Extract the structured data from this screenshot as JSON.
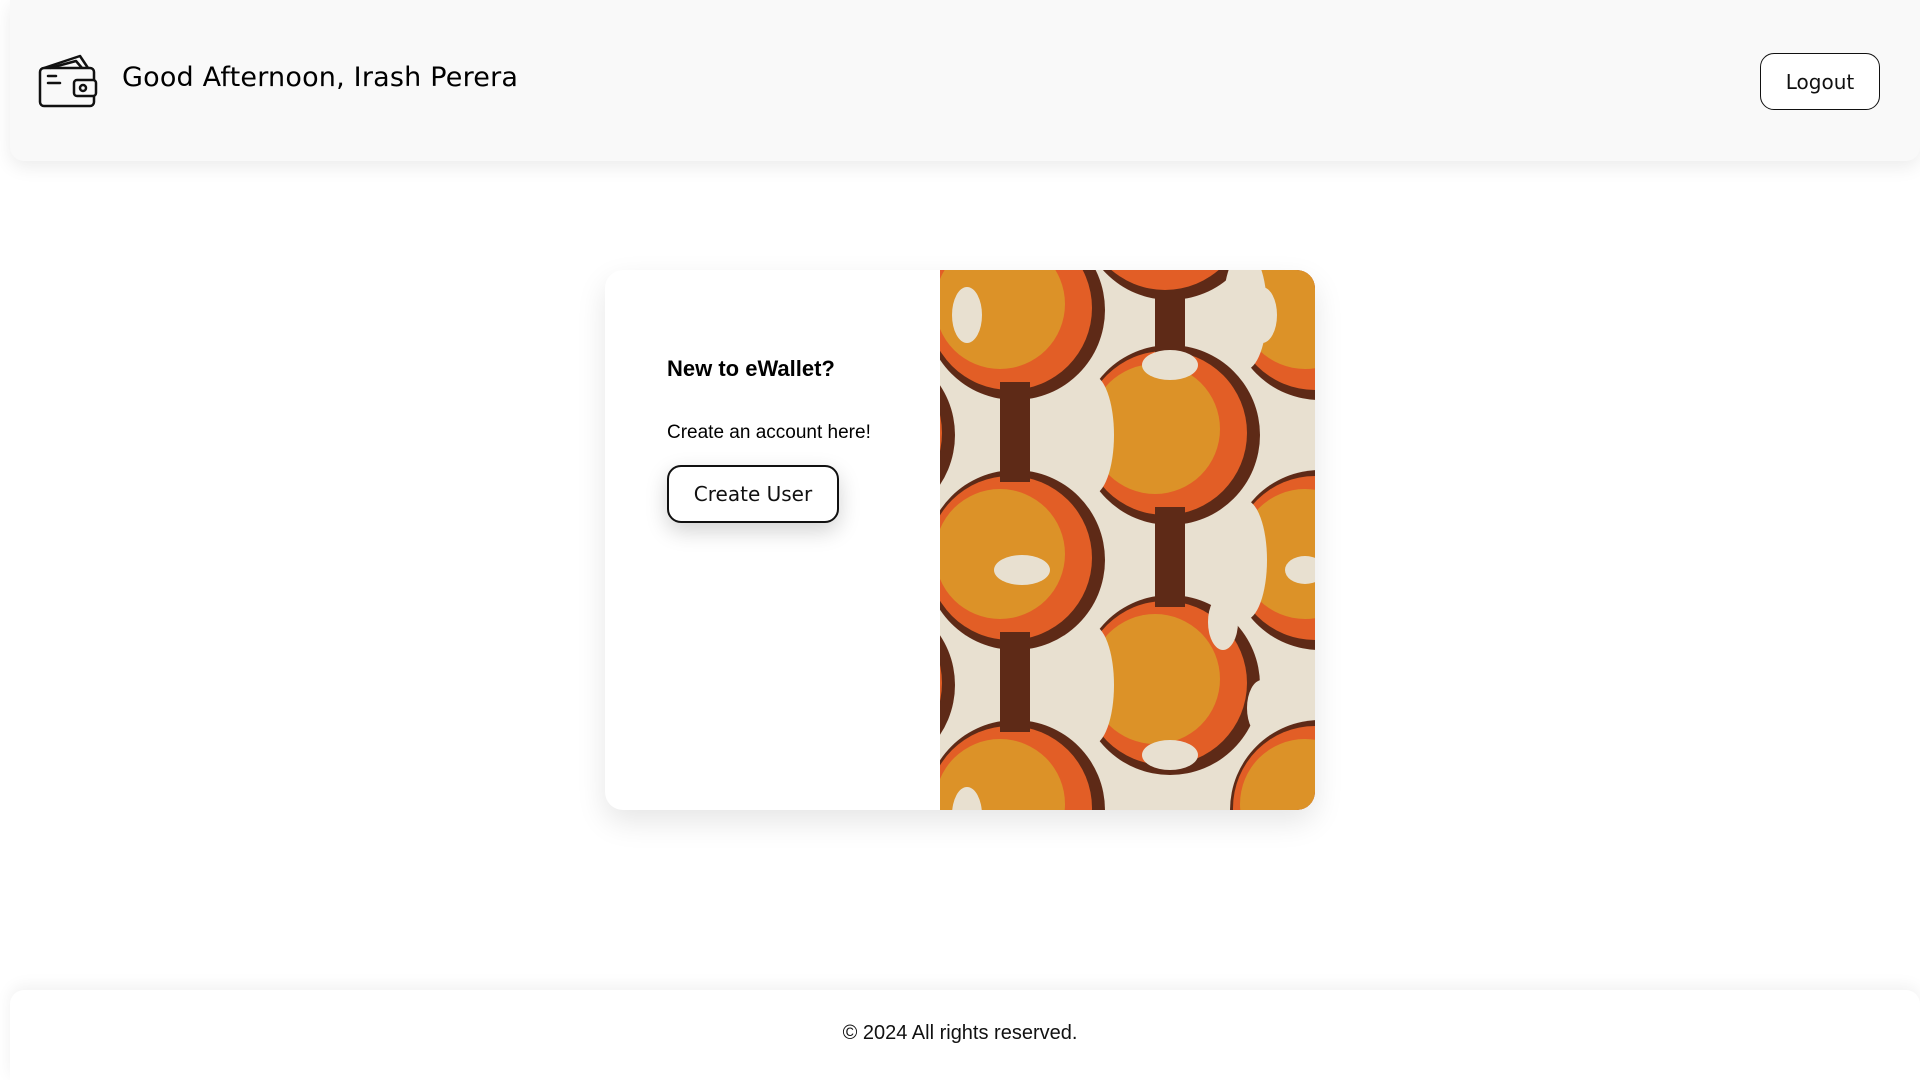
{
  "header": {
    "greeting": "Good Afternoon, Irash Perera",
    "logo_icon": "wallet-icon",
    "logout_label": "Logout"
  },
  "card": {
    "title": "New to eWallet?",
    "text": "Create an account here!",
    "button_label": "Create User",
    "image_icon": "retro-orange-circles-pattern",
    "colors": {
      "cream": "#e8e0d0",
      "brown": "#5e2a17",
      "orange": "#e25e26",
      "gold": "#dc9228"
    }
  },
  "footer": {
    "text": "© 2024 All rights reserved."
  }
}
